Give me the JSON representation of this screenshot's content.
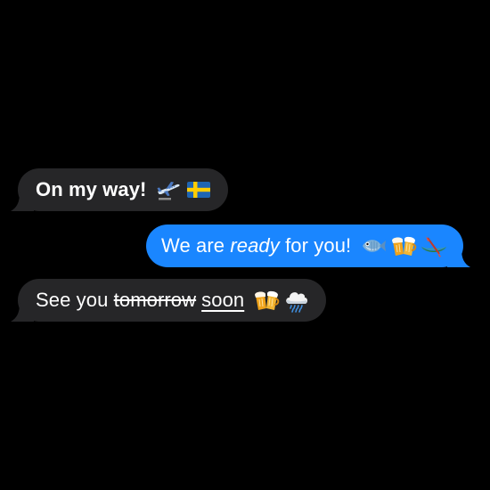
{
  "messages": [
    {
      "direction": "incoming",
      "text": "On my way!",
      "icons": [
        "airplane-departure-icon",
        "sweden-flag-icon"
      ]
    },
    {
      "direction": "outgoing",
      "before": "We are ",
      "emphasis": "ready",
      "after": " for you!",
      "icons": [
        "fish-icon",
        "beer-mugs-icon",
        "canoe-icon"
      ]
    },
    {
      "direction": "incoming",
      "before": "See you ",
      "strikethrough": "tomorrow",
      "underlined": "soon",
      "icons": [
        "beer-mugs-icon",
        "rain-cloud-icon"
      ]
    }
  ],
  "colors": {
    "background": "#000000",
    "incoming_bubble": "#262628",
    "outgoing_bubble": "#1a86ff",
    "text": "#ffffff"
  }
}
